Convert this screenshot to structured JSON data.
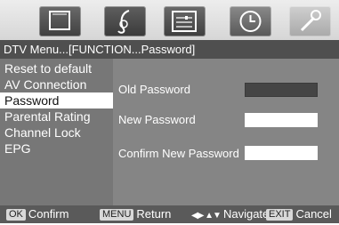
{
  "tabs": [
    {
      "icon": "tv-icon"
    },
    {
      "icon": "music-note-icon"
    },
    {
      "icon": "settings-panel-icon"
    },
    {
      "icon": "clock-icon"
    },
    {
      "icon": "wrench-icon"
    }
  ],
  "breadcrumb": "DTV Menu...[FUNCTION...Password]",
  "menu": {
    "items": [
      "Reset to default",
      "AV Connection",
      "Password",
      "Parental Rating",
      "Channel Lock",
      "EPG"
    ],
    "selected": "Password"
  },
  "form": {
    "old_label": "Old Password",
    "new_label": "New Password",
    "confirm_label": "Confirm New Password"
  },
  "hints": {
    "ok_key": "OK",
    "ok_label": "Confirm",
    "menu_key": "MENU",
    "menu_label": "Return",
    "nav_label": "Navigate",
    "exit_key": "EXIT",
    "exit_label": "Cancel"
  },
  "colors": {
    "selected_bg": "#ffffff",
    "panel_bg": "#858585",
    "menu_bg": "#777777"
  }
}
